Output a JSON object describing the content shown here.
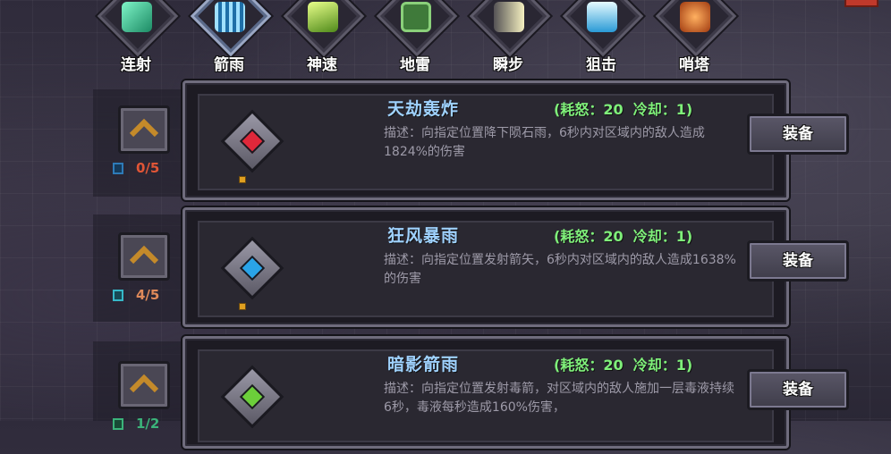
{
  "skill_tabs": [
    {
      "label": "连射",
      "icon": "multishot-icon",
      "color": "#3fd6a0"
    },
    {
      "label": "箭雨",
      "icon": "arrow-rain-icon",
      "color": "#4fb4ff"
    },
    {
      "label": "神速",
      "icon": "swift-icon",
      "color": "#a6e34a"
    },
    {
      "label": "地雷",
      "icon": "landmine-icon",
      "color": "#5aa055"
    },
    {
      "label": "瞬步",
      "icon": "blink-icon",
      "color": "#e6e2a0"
    },
    {
      "label": "狙击",
      "icon": "snipe-icon",
      "color": "#6fd7ff"
    },
    {
      "label": "哨塔",
      "icon": "sentry-tower-icon",
      "color": "#e06a2a"
    }
  ],
  "skills": [
    {
      "name": "天劫轰炸",
      "stats": "(耗怒：20  冷却：1)",
      "desc": "描述：向指定位置降下陨石雨，6秒内对区域内的敌人造成1824%的伤害",
      "level": "0/5",
      "gem_color": "#e0283a",
      "equip": "装备"
    },
    {
      "name": "狂风暴雨",
      "stats": "(耗怒：20  冷却：1)",
      "desc": "描述：向指定位置发射箭矢，6秒内对区域内的敌人造成1638%的伤害",
      "level": "4/5",
      "gem_color": "#2aa4e8",
      "equip": "装备"
    },
    {
      "name": "暗影箭雨",
      "stats": "(耗怒：20  冷却：1)",
      "desc": "描述：向指定位置发射毒箭，对区域内的敌人施加一层毒液持续6秒，毒液每秒造成160%伤害，",
      "level": "1/2",
      "gem_color": "#6ccf3a",
      "equip": "装备"
    }
  ]
}
